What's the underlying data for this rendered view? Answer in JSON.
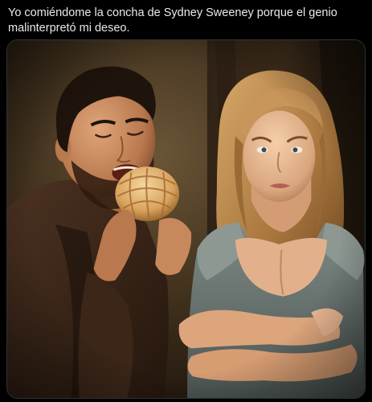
{
  "post": {
    "text": "Yo comiéndome la concha de Sydney Sweeney porque el genio\nmalinterpretó mi deseo."
  },
  "colors": {
    "background": "#000000",
    "text": "#e7e9ea",
    "media_border": "#2f3336"
  }
}
